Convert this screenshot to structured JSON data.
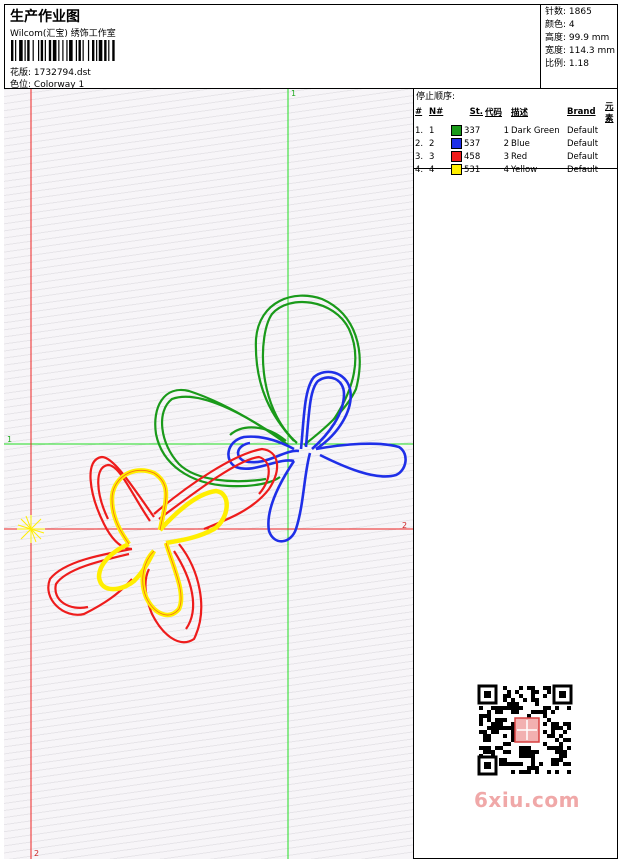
{
  "header": {
    "title": "生产作业图",
    "company": "Wilcom(汇宝) 绣饰工作室",
    "design_label": "花版:",
    "design_value": "1732794.dst",
    "colorway_label": "色位:",
    "colorway_value": "Colorway 1"
  },
  "stats": {
    "stitches": "针数: 1865",
    "colors": "颜色: 4",
    "height": "高度: 99.9 mm",
    "width": "宽度: 114.3 mm",
    "ratio": "比例: 1.18"
  },
  "canvas": {
    "guide_label_v_top": "1",
    "guide_label_h_left": "1",
    "guide_label_h_right": "2",
    "guide_label_v_bottom": "2"
  },
  "legend": {
    "title": "停止顺序:",
    "columns": [
      "#",
      "N#",
      "St.",
      "代码",
      "描述",
      "Brand",
      "元素"
    ],
    "rows": [
      {
        "idx": "1.",
        "n": "1",
        "st": "337",
        "code": "1",
        "desc": "Dark Green",
        "brand": "Default",
        "color": "#1a9a1a"
      },
      {
        "idx": "2.",
        "n": "2",
        "st": "537",
        "code": "2",
        "desc": "Blue",
        "brand": "Default",
        "color": "#1f2fe8"
      },
      {
        "idx": "3.",
        "n": "3",
        "st": "458",
        "code": "3",
        "desc": "Red",
        "brand": "Default",
        "color": "#ee1c1c"
      },
      {
        "idx": "4.",
        "n": "4",
        "st": "531",
        "code": "4",
        "desc": "Yellow",
        "brand": "Default",
        "color": "#ffee00"
      }
    ]
  },
  "footer": {
    "logo_text": "6xiu.com"
  }
}
